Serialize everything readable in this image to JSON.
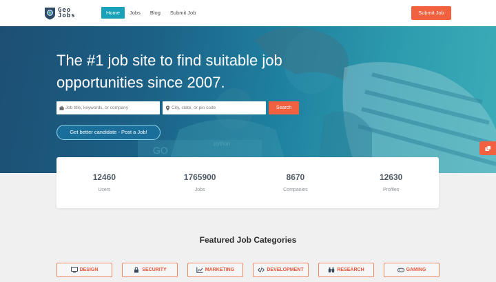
{
  "colors": {
    "accent": "#f2613f",
    "active_nav": "#17a2b8",
    "hero_blue": "#1b5f86"
  },
  "brand": {
    "logo_text_line1": "Geo",
    "logo_text_line2": "Jobs"
  },
  "nav": {
    "links": [
      {
        "label": "Home",
        "active": true
      },
      {
        "label": "Jobs",
        "active": false
      },
      {
        "label": "Blog",
        "active": false
      },
      {
        "label": "Submit Job",
        "active": false
      }
    ],
    "cta_label": "Submit Job"
  },
  "hero": {
    "title": "The #1 job site to find suitable job opportunities since 2007.",
    "keyword_placeholder": "Job title, keywords, or company",
    "location_placeholder": "City, state, or pin code",
    "search_label": "Search",
    "post_job_label": "Get better candidate - Post a Job!",
    "keyword_icon": "briefcase-icon",
    "location_icon": "map-pin-icon",
    "chat_icon": "chat-icon"
  },
  "stats": [
    {
      "value": "12460",
      "label": "Users"
    },
    {
      "value": "1765900",
      "label": "Jobs"
    },
    {
      "value": "8670",
      "label": "Companies"
    },
    {
      "value": "12630",
      "label": "Profiles"
    }
  ],
  "featured": {
    "title": "Featured Job Categories",
    "categories": [
      {
        "label": "DESIGN",
        "icon": "monitor-icon"
      },
      {
        "label": "SECURITY",
        "icon": "lock-icon"
      },
      {
        "label": "MARKETING",
        "icon": "chart-icon"
      },
      {
        "label": "DEVELOPMENT",
        "icon": "code-icon"
      },
      {
        "label": "RESEARCH",
        "icon": "binoculars-icon"
      },
      {
        "label": "GAMING",
        "icon": "gamepad-icon"
      }
    ]
  }
}
